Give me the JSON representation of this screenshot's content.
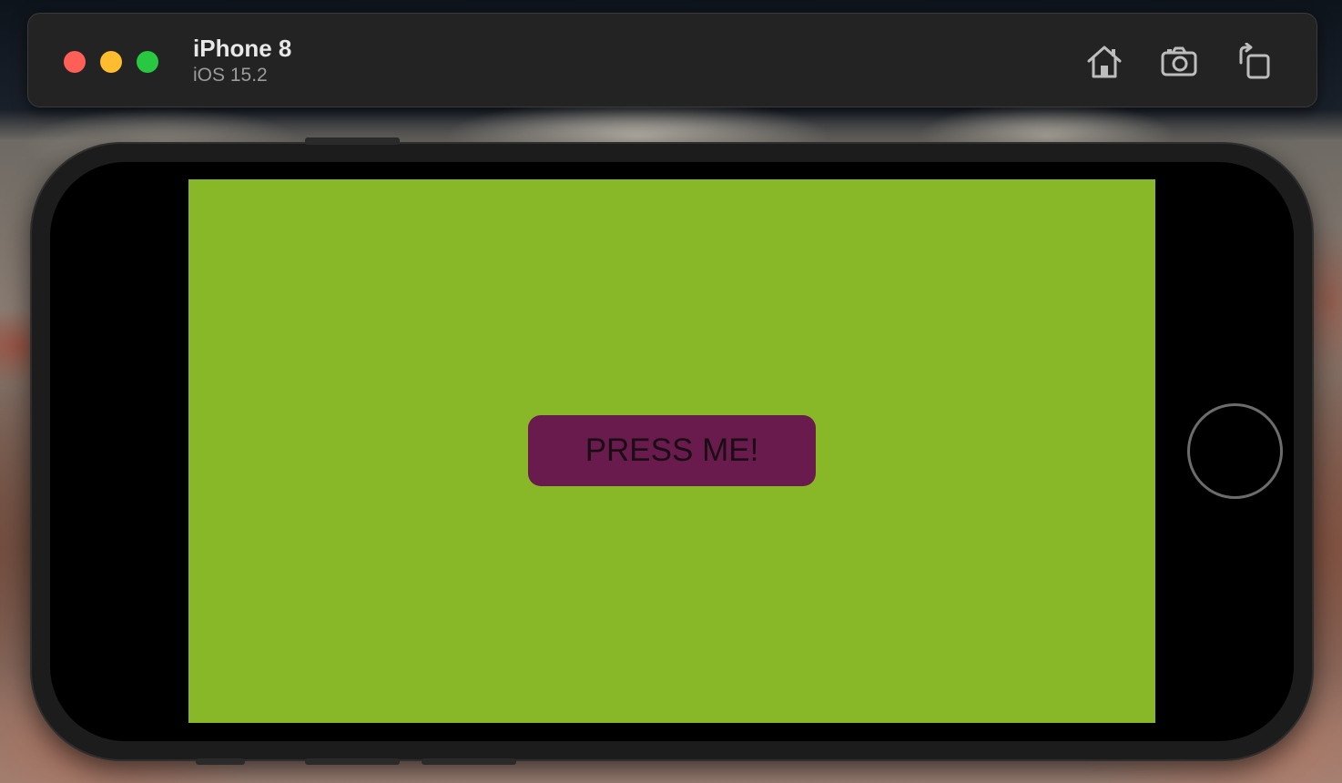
{
  "titlebar": {
    "device_name": "iPhone 8",
    "os_version": "iOS 15.2",
    "window_controls": [
      {
        "name": "close",
        "color": "#fe5f57"
      },
      {
        "name": "minimize",
        "color": "#febc2e"
      },
      {
        "name": "zoom",
        "color": "#28c840"
      }
    ],
    "toolbar_icons": [
      "home-icon",
      "screenshot-icon",
      "rotate-icon"
    ]
  },
  "app": {
    "background_color": "#88b827",
    "button_label": "PRESS ME!",
    "button_color": "#6a1b4d"
  }
}
